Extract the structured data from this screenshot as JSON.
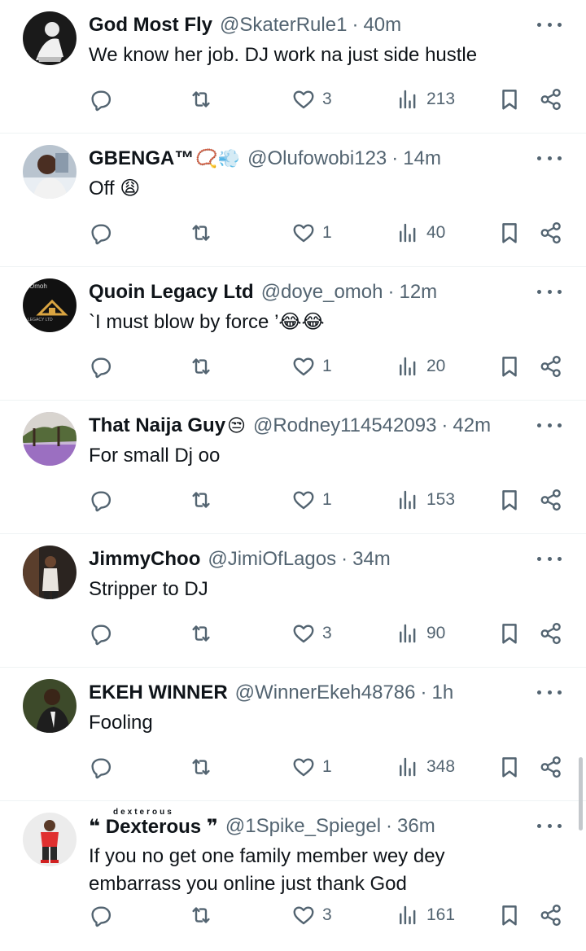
{
  "tweets": [
    {
      "name": "God Most Fly",
      "emoji": "",
      "handle": "@SkaterRule1",
      "time": "40m",
      "text": "We know her job. DJ work na just side hustle",
      "replies": "",
      "retweets": "",
      "likes": "3",
      "views": "213"
    },
    {
      "name": "GBENGA™",
      "emoji": "📿💨",
      "handle": "@Olufowobi123",
      "time": "14m",
      "text": "Off 😩",
      "replies": "",
      "retweets": "",
      "likes": "1",
      "views": "40"
    },
    {
      "name": "Quoin Legacy Ltd",
      "emoji": "",
      "handle": "@doye_omoh",
      "time": "12m",
      "text": "`I must blow by force ’😂😂",
      "replies": "",
      "retweets": "",
      "likes": "1",
      "views": "20",
      "avatar_text": [
        "Omoh",
        "LEGACY LTD"
      ]
    },
    {
      "name": "That Naija Guy",
      "emoji": "😒",
      "handle": "@Rodney114542093",
      "time": "42m",
      "text": "For small Dj oo",
      "replies": "",
      "retweets": "",
      "likes": "1",
      "views": "153"
    },
    {
      "name": "JimmyChoo",
      "emoji": "",
      "handle": "@JimiOfLagos",
      "time": "34m",
      "text": "Stripper to DJ",
      "replies": "",
      "retweets": "",
      "likes": "3",
      "views": "90"
    },
    {
      "name": "EKEH WINNER",
      "emoji": "",
      "handle": "@WinnerEkeh48786",
      "time": "1h",
      "text": "Fooling",
      "replies": "",
      "retweets": "",
      "likes": "1",
      "views": "348"
    },
    {
      "name": "❝ Dexterous ❞",
      "name_small": "dexterous",
      "emoji": "",
      "handle": "@1Spike_Spiegel",
      "time": "36m",
      "text": "If you no get one family member wey dey embarrass you online just thank God",
      "replies": "",
      "retweets": "",
      "likes": "3",
      "views": "161"
    }
  ],
  "separator": "·",
  "icons": {
    "reply": "reply-icon",
    "retweet": "retweet-icon",
    "like": "heart-icon",
    "views": "views-icon",
    "bookmark": "bookmark-icon",
    "share": "share-icon",
    "more": "more-icon"
  },
  "colors": {
    "text": "#0f1419",
    "secondary": "#536471",
    "divider": "#eff3f4"
  }
}
